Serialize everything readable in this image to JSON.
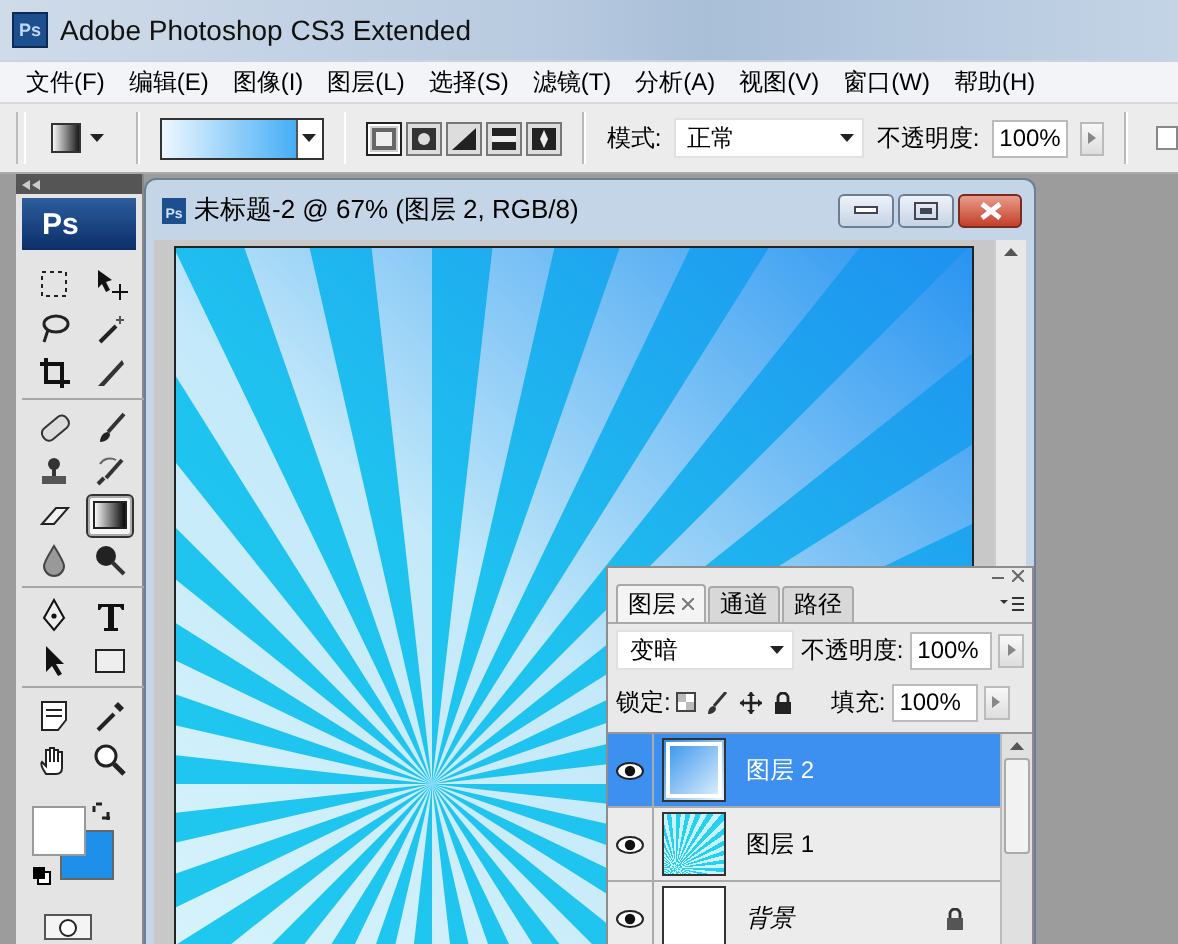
{
  "app": {
    "logo": "Ps",
    "title": "Adobe Photoshop CS3 Extended"
  },
  "menu": [
    "文件(F)",
    "编辑(E)",
    "图像(I)",
    "图层(L)",
    "选择(S)",
    "滤镜(T)",
    "分析(A)",
    "视图(V)",
    "窗口(W)",
    "帮助(H)"
  ],
  "options": {
    "gradient_types": [
      {
        "selected": true
      },
      {
        "selected": false
      },
      {
        "selected": false
      },
      {
        "selected": false
      },
      {
        "selected": false
      }
    ],
    "mode_label": "模式:",
    "mode": "正常",
    "opacity_label": "不透明度:",
    "opacity": "100%",
    "checkbox": {
      "checked": false
    }
  },
  "toolbox": {
    "logo": "Ps",
    "tools": [
      {
        "kind": "marquee",
        "selected": false
      },
      {
        "kind": "move",
        "selected": false
      },
      {
        "kind": "lasso",
        "selected": false
      },
      {
        "kind": "wand",
        "selected": false
      },
      {
        "kind": "crop",
        "selected": false
      },
      {
        "kind": "slice",
        "selected": false
      },
      {
        "kind": "heal",
        "selected": false
      },
      {
        "kind": "brush",
        "selected": false
      },
      {
        "kind": "stamp",
        "selected": false
      },
      {
        "kind": "history",
        "selected": false
      },
      {
        "kind": "eraser",
        "selected": false
      },
      {
        "kind": "gradient",
        "selected": true
      },
      {
        "kind": "blur",
        "selected": false
      },
      {
        "kind": "dodge",
        "selected": false
      },
      {
        "kind": "pen",
        "selected": false
      },
      {
        "kind": "type",
        "selected": false
      },
      {
        "kind": "pointer",
        "selected": false
      },
      {
        "kind": "shape",
        "selected": false
      },
      {
        "kind": "notes",
        "selected": false
      },
      {
        "kind": "eyedropper",
        "selected": false
      },
      {
        "kind": "hand",
        "selected": false
      },
      {
        "kind": "zoom",
        "selected": false
      }
    ]
  },
  "document": {
    "icon_label": "Ps",
    "title": "未标题-2 @ 67% (图层 2, RGB/8)"
  },
  "layers_panel": {
    "tabs": [
      {
        "label": "图层",
        "selected": true,
        "closable": true
      },
      {
        "label": "通道",
        "selected": false,
        "closable": false
      },
      {
        "label": "路径",
        "selected": false,
        "closable": false
      }
    ],
    "blend_mode": "变暗",
    "opacity_label": "不透明度:",
    "opacity": "100%",
    "lock_label": "锁定:",
    "fill_label": "填充:",
    "fill": "100%",
    "layers": [
      {
        "name": "图层 2",
        "kind": "gradient",
        "selected": true,
        "visible": true,
        "locked": false
      },
      {
        "name": "图层 1",
        "kind": "rays",
        "selected": false,
        "visible": true,
        "locked": false
      },
      {
        "name": "背景",
        "kind": "background",
        "selected": false,
        "visible": true,
        "locked": true
      }
    ]
  }
}
